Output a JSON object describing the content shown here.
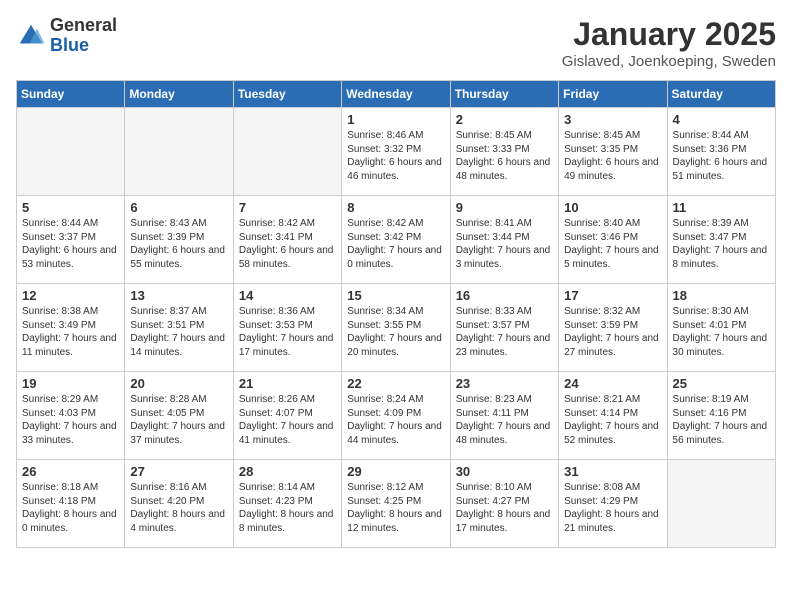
{
  "logo": {
    "general": "General",
    "blue": "Blue"
  },
  "header": {
    "month": "January 2025",
    "location": "Gislaved, Joenkoeping, Sweden"
  },
  "weekdays": [
    "Sunday",
    "Monday",
    "Tuesday",
    "Wednesday",
    "Thursday",
    "Friday",
    "Saturday"
  ],
  "weeks": [
    [
      {
        "day": "",
        "empty": true
      },
      {
        "day": "",
        "empty": true
      },
      {
        "day": "",
        "empty": true
      },
      {
        "day": "1",
        "sunrise": "8:46 AM",
        "sunset": "3:32 PM",
        "daylight": "6 hours and 46 minutes."
      },
      {
        "day": "2",
        "sunrise": "8:45 AM",
        "sunset": "3:33 PM",
        "daylight": "6 hours and 48 minutes."
      },
      {
        "day": "3",
        "sunrise": "8:45 AM",
        "sunset": "3:35 PM",
        "daylight": "6 hours and 49 minutes."
      },
      {
        "day": "4",
        "sunrise": "8:44 AM",
        "sunset": "3:36 PM",
        "daylight": "6 hours and 51 minutes."
      }
    ],
    [
      {
        "day": "5",
        "sunrise": "8:44 AM",
        "sunset": "3:37 PM",
        "daylight": "6 hours and 53 minutes."
      },
      {
        "day": "6",
        "sunrise": "8:43 AM",
        "sunset": "3:39 PM",
        "daylight": "6 hours and 55 minutes."
      },
      {
        "day": "7",
        "sunrise": "8:42 AM",
        "sunset": "3:41 PM",
        "daylight": "6 hours and 58 minutes."
      },
      {
        "day": "8",
        "sunrise": "8:42 AM",
        "sunset": "3:42 PM",
        "daylight": "7 hours and 0 minutes."
      },
      {
        "day": "9",
        "sunrise": "8:41 AM",
        "sunset": "3:44 PM",
        "daylight": "7 hours and 3 minutes."
      },
      {
        "day": "10",
        "sunrise": "8:40 AM",
        "sunset": "3:46 PM",
        "daylight": "7 hours and 5 minutes."
      },
      {
        "day": "11",
        "sunrise": "8:39 AM",
        "sunset": "3:47 PM",
        "daylight": "7 hours and 8 minutes."
      }
    ],
    [
      {
        "day": "12",
        "sunrise": "8:38 AM",
        "sunset": "3:49 PM",
        "daylight": "7 hours and 11 minutes."
      },
      {
        "day": "13",
        "sunrise": "8:37 AM",
        "sunset": "3:51 PM",
        "daylight": "7 hours and 14 minutes."
      },
      {
        "day": "14",
        "sunrise": "8:36 AM",
        "sunset": "3:53 PM",
        "daylight": "7 hours and 17 minutes."
      },
      {
        "day": "15",
        "sunrise": "8:34 AM",
        "sunset": "3:55 PM",
        "daylight": "7 hours and 20 minutes."
      },
      {
        "day": "16",
        "sunrise": "8:33 AM",
        "sunset": "3:57 PM",
        "daylight": "7 hours and 23 minutes."
      },
      {
        "day": "17",
        "sunrise": "8:32 AM",
        "sunset": "3:59 PM",
        "daylight": "7 hours and 27 minutes."
      },
      {
        "day": "18",
        "sunrise": "8:30 AM",
        "sunset": "4:01 PM",
        "daylight": "7 hours and 30 minutes."
      }
    ],
    [
      {
        "day": "19",
        "sunrise": "8:29 AM",
        "sunset": "4:03 PM",
        "daylight": "7 hours and 33 minutes."
      },
      {
        "day": "20",
        "sunrise": "8:28 AM",
        "sunset": "4:05 PM",
        "daylight": "7 hours and 37 minutes."
      },
      {
        "day": "21",
        "sunrise": "8:26 AM",
        "sunset": "4:07 PM",
        "daylight": "7 hours and 41 minutes."
      },
      {
        "day": "22",
        "sunrise": "8:24 AM",
        "sunset": "4:09 PM",
        "daylight": "7 hours and 44 minutes."
      },
      {
        "day": "23",
        "sunrise": "8:23 AM",
        "sunset": "4:11 PM",
        "daylight": "7 hours and 48 minutes."
      },
      {
        "day": "24",
        "sunrise": "8:21 AM",
        "sunset": "4:14 PM",
        "daylight": "7 hours and 52 minutes."
      },
      {
        "day": "25",
        "sunrise": "8:19 AM",
        "sunset": "4:16 PM",
        "daylight": "7 hours and 56 minutes."
      }
    ],
    [
      {
        "day": "26",
        "sunrise": "8:18 AM",
        "sunset": "4:18 PM",
        "daylight": "8 hours and 0 minutes."
      },
      {
        "day": "27",
        "sunrise": "8:16 AM",
        "sunset": "4:20 PM",
        "daylight": "8 hours and 4 minutes."
      },
      {
        "day": "28",
        "sunrise": "8:14 AM",
        "sunset": "4:23 PM",
        "daylight": "8 hours and 8 minutes."
      },
      {
        "day": "29",
        "sunrise": "8:12 AM",
        "sunset": "4:25 PM",
        "daylight": "8 hours and 12 minutes."
      },
      {
        "day": "30",
        "sunrise": "8:10 AM",
        "sunset": "4:27 PM",
        "daylight": "8 hours and 17 minutes."
      },
      {
        "day": "31",
        "sunrise": "8:08 AM",
        "sunset": "4:29 PM",
        "daylight": "8 hours and 21 minutes."
      },
      {
        "day": "",
        "empty": true
      }
    ]
  ],
  "labels": {
    "sunrise_prefix": "Sunrise: ",
    "sunset_prefix": "Sunset: ",
    "daylight_prefix": "Daylight: "
  }
}
